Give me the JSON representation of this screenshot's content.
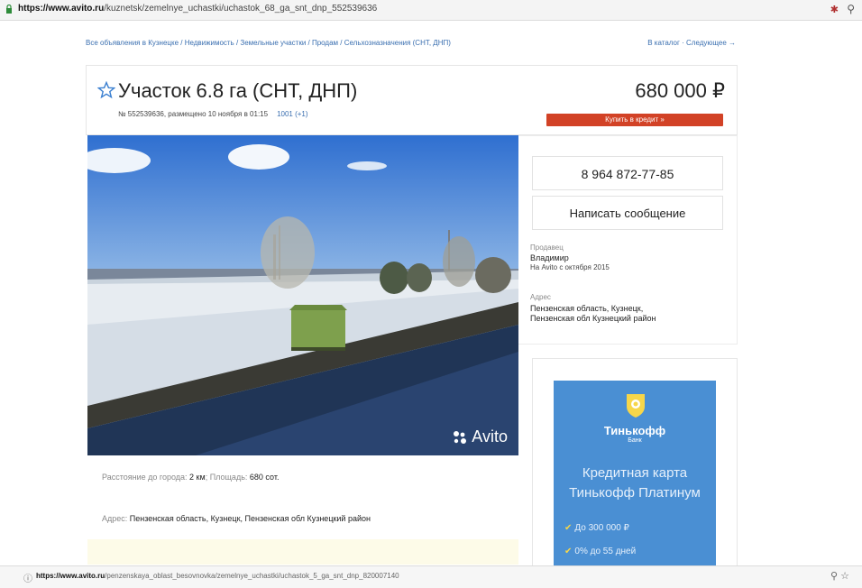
{
  "browser": {
    "url_top_domain": "https://www.avito.ru",
    "url_top_path": "/kuznetsk/zemelnye_uchastki/uchastok_68_ga_snt_dnp_552539636",
    "url_bottom_domain": "https://www.avito.ru",
    "url_bottom_path": "/penzenskaya_oblast_besovnovka/zemelnye_uchastki/uchastok_5_ga_snt_dnp_820007140"
  },
  "breadcrumbs": "Все объявления в Кузнецке / Недвижимость / Земельные участки / Продам / Сельхозназначения (СНТ, ДНП)",
  "nav_right": "В каталог · Следующее →",
  "listing": {
    "title": "Участок 6.8 га (СНТ, ДНП)",
    "meta": "№ 552539636, размещено 10 ноября в 01:15",
    "views": "1001 (+1)",
    "price": "680 000 ₽",
    "credit_button": "Купить в кредит »"
  },
  "contact": {
    "phone": "8 964 872-77-85",
    "message_button": "Написать сообщение",
    "seller_label": "Продавец",
    "seller_name": "Владимир",
    "seller_since": "На Avito с октября 2015",
    "address_label": "Адрес",
    "address_line1": "Пензенская область, Кузнецк,",
    "address_line2": "Пензенская обл Кузнецкий район"
  },
  "details": {
    "distance_label": "Расстояние до города:",
    "distance_value": "2 км",
    "area_label": "Площадь:",
    "area_value": "680 сот.",
    "address_label": "Адрес:",
    "address_value": "Пензенская область, Кузнецк, Пензенская обл Кузнецкий район"
  },
  "photo": {
    "watermark": "Avito"
  },
  "ad": {
    "brand": "Тинькофф",
    "brand_sub": "Банк",
    "headline_line1": "Кредитная карта",
    "headline_line2": "Тинькофф Платинум",
    "bullet1": "До 300 000 ₽",
    "bullet2": "0% до 55 дней"
  },
  "colors": {
    "link": "#3a6fb0",
    "credit_button": "#d24226",
    "ad_background": "#4a8fd3"
  },
  "icons": [
    "lock-icon",
    "star-icon",
    "info-icon",
    "avito-logo-icon",
    "tinkoff-emblem-icon",
    "check-icon",
    "zoom-icon",
    "bookmark-star-icon"
  ]
}
